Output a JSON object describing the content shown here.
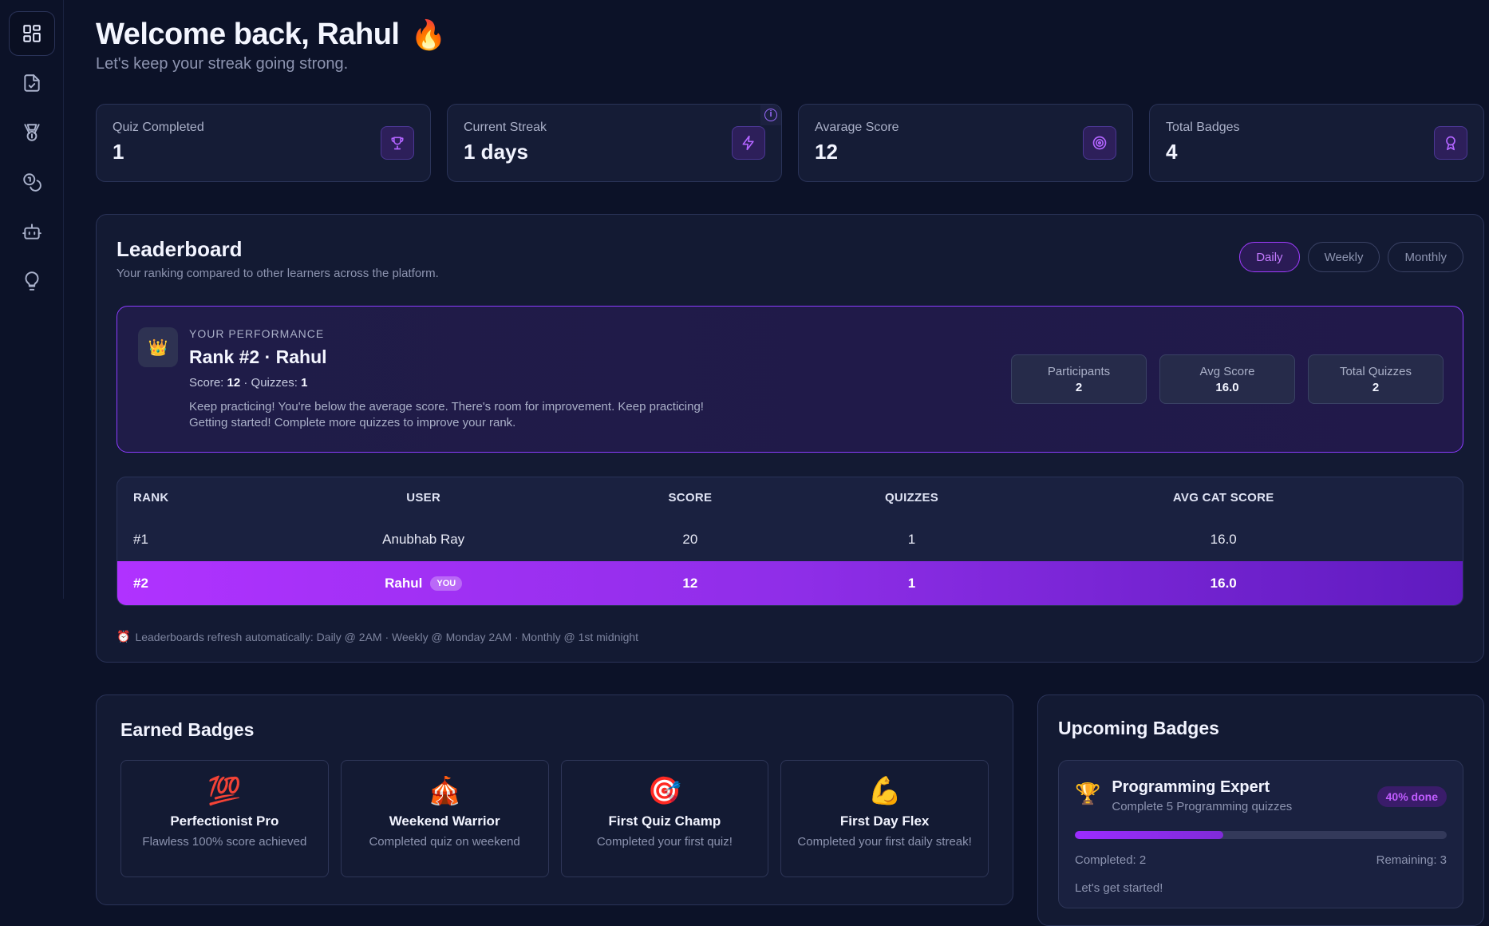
{
  "header": {
    "title": "Welcome back, Rahul",
    "emoji": "🔥",
    "subtitle": "Let's keep your streak going strong."
  },
  "sidebar": {
    "items": [
      {
        "icon": "dashboard-icon",
        "active": true
      },
      {
        "icon": "document-check-icon",
        "active": false
      },
      {
        "icon": "medal-icon",
        "active": false
      },
      {
        "icon": "coins-icon",
        "active": false
      },
      {
        "icon": "robot-icon",
        "active": false
      },
      {
        "icon": "lightbulb-icon",
        "active": false
      }
    ]
  },
  "stats": [
    {
      "label": "Quiz Completed",
      "value": "1",
      "icon": "trophy-icon"
    },
    {
      "label": "Current Streak",
      "value": "1 days",
      "icon": "lightning-icon",
      "info": "i"
    },
    {
      "label": "Avarage Score",
      "value": "12",
      "icon": "target-icon"
    },
    {
      "label": "Total Badges",
      "value": "4",
      "icon": "award-icon"
    }
  ],
  "leaderboard": {
    "title": "Leaderboard",
    "subtitle": "Your ranking compared to other learners across the platform.",
    "tabs": [
      "Daily",
      "Weekly",
      "Monthly"
    ],
    "active_tab": "Daily",
    "performance": {
      "kicker": "YOUR PERFORMANCE",
      "emoji": "👑",
      "rank_line": "Rank #2 · Rahul",
      "score_label": "Score: ",
      "score": "12",
      "quizzes_label": " · Quizzes: ",
      "quizzes": "1",
      "message_1": "Keep practicing! You're below the average score. There's room for improvement. Keep practicing!",
      "message_2": "Getting started! Complete more quizzes to improve your rank.",
      "stats": [
        {
          "label": "Participants",
          "value": "2"
        },
        {
          "label": "Avg Score",
          "value": "16.0"
        },
        {
          "label": "Total Quizzes",
          "value": "2"
        }
      ]
    },
    "columns": [
      "RANK",
      "USER",
      "SCORE",
      "QUIZZES",
      "AVG CAT SCORE"
    ],
    "rows": [
      {
        "rank": "#1",
        "user": "Anubhab Ray",
        "score": "20",
        "quizzes": "1",
        "avg": "16.0"
      },
      {
        "rank": "#2",
        "user": "Rahul",
        "you": "YOU",
        "score": "12",
        "quizzes": "1",
        "avg": "16.0"
      }
    ],
    "footer_emoji": "⏰",
    "footer": "Leaderboards refresh automatically: Daily @ 2AM · Weekly @ Monday 2AM · Monthly @ 1st midnight"
  },
  "earned_badges": {
    "title": "Earned Badges",
    "items": [
      {
        "emoji": "💯",
        "name": "Perfectionist Pro",
        "desc": "Flawless 100% score achieved"
      },
      {
        "emoji": "🎪",
        "name": "Weekend Warrior",
        "desc": "Completed quiz on weekend"
      },
      {
        "emoji": "🎯",
        "name": "First Quiz Champ",
        "desc": "Completed your first quiz!"
      },
      {
        "emoji": "💪",
        "name": "First Day Flex",
        "desc": "Completed your first daily streak!"
      }
    ]
  },
  "upcoming_badges": {
    "title": "Upcoming Badges",
    "card": {
      "emoji": "🏆",
      "name": "Programming Expert",
      "desc": "Complete 5 Programming quizzes",
      "progress_label": "40% done",
      "progress": 0.4,
      "completed": "Completed: 2",
      "remaining": "Remaining: 3",
      "footer": "Let's get started!"
    }
  },
  "colors": {
    "background": "#0c1228",
    "accent": "#a03cff",
    "panel": "#131a33"
  }
}
